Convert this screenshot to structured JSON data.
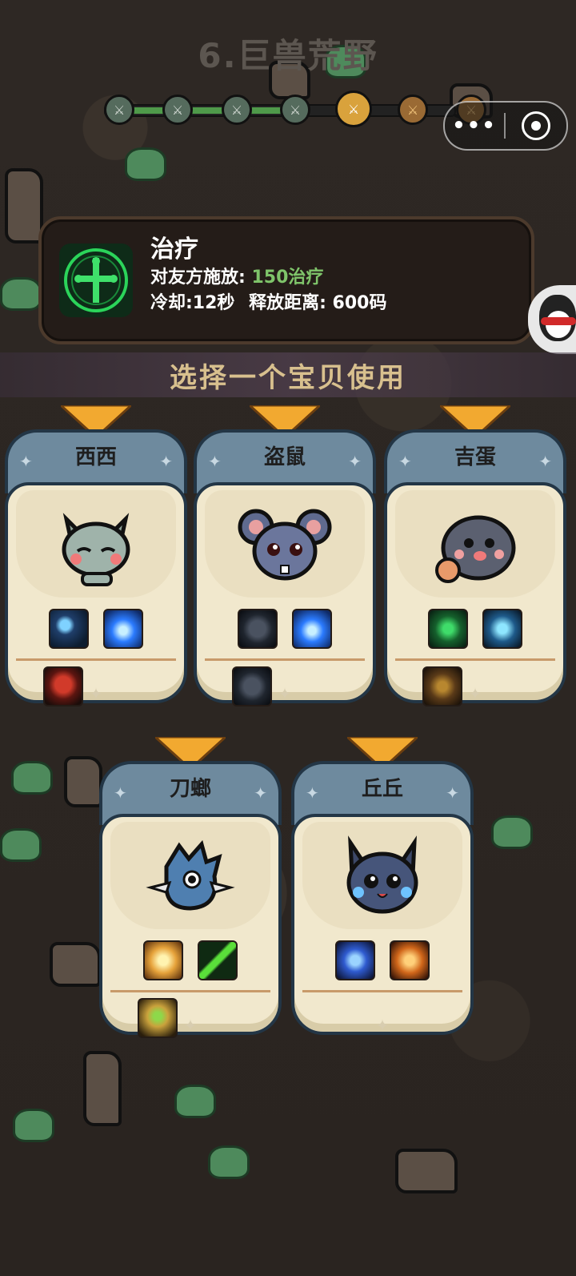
{
  "stage": {
    "title": "6.巨兽荒野"
  },
  "progress": {
    "nodes": [
      "done",
      "done",
      "done",
      "done",
      "current",
      "future",
      "future"
    ],
    "fraction": 0.58
  },
  "miniprogram_capsule": {
    "more_icon": "more-dots-icon",
    "close_icon": "close-target-icon"
  },
  "skill": {
    "name": "治疗",
    "icon": "green-cross-rune-icon",
    "effect_label": "对友方施放:",
    "effect_value": "150治疗",
    "cooldown_text": "冷却:12秒",
    "range_text": "释放距离: 600码",
    "accent_color": "#7fc46a"
  },
  "choose_banner": "选择一个宝贝使用",
  "pets": [
    {
      "name": "西西",
      "row1": [
        "s-blue-slash",
        "s-blue-orb"
      ],
      "row2": [
        "s-red-bat"
      ]
    },
    {
      "name": "盗鼠",
      "row1": [
        "s-dark-bug",
        "s-blue-orb"
      ],
      "row2": [
        "s-dark-bug"
      ]
    },
    {
      "name": "吉蛋",
      "row1": [
        "s-green-cross",
        "s-blue-swirl"
      ],
      "row2": [
        "s-brown-wheel"
      ]
    },
    {
      "name": "刀螂",
      "row1": [
        "s-sun",
        "s-green-sword"
      ],
      "row2": [
        "s-gold-amulet"
      ]
    },
    {
      "name": "丘丘",
      "row1": [
        "s-blue-lightning",
        "s-fire-shield"
      ],
      "row2": []
    }
  ]
}
